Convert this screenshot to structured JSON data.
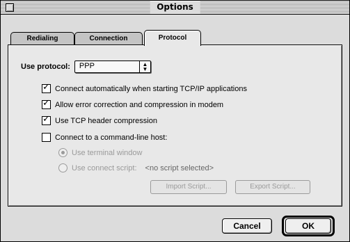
{
  "window": {
    "title": "Options"
  },
  "tabs": [
    {
      "label": "Redialing",
      "active": false
    },
    {
      "label": "Connection",
      "active": false
    },
    {
      "label": "Protocol",
      "active": true
    }
  ],
  "protocol": {
    "use_protocol_label": "Use protocol:",
    "selected_protocol": "PPP",
    "options": [
      {
        "label": "Connect automatically when starting TCP/IP applications",
        "checked": true
      },
      {
        "label": "Allow error correction and compression in modem",
        "checked": true
      },
      {
        "label": "Use TCP header compression",
        "checked": true
      },
      {
        "label": "Connect to a command-line host:",
        "checked": false
      }
    ],
    "host_modes": [
      {
        "label": "Use terminal window",
        "selected": true,
        "enabled": false
      },
      {
        "label": "Use connect script:",
        "selected": false,
        "enabled": false
      }
    ],
    "script_name": "<no script selected>",
    "import_label": "Import Script...",
    "export_label": "Export Script..."
  },
  "buttons": {
    "cancel": "Cancel",
    "ok": "OK"
  }
}
